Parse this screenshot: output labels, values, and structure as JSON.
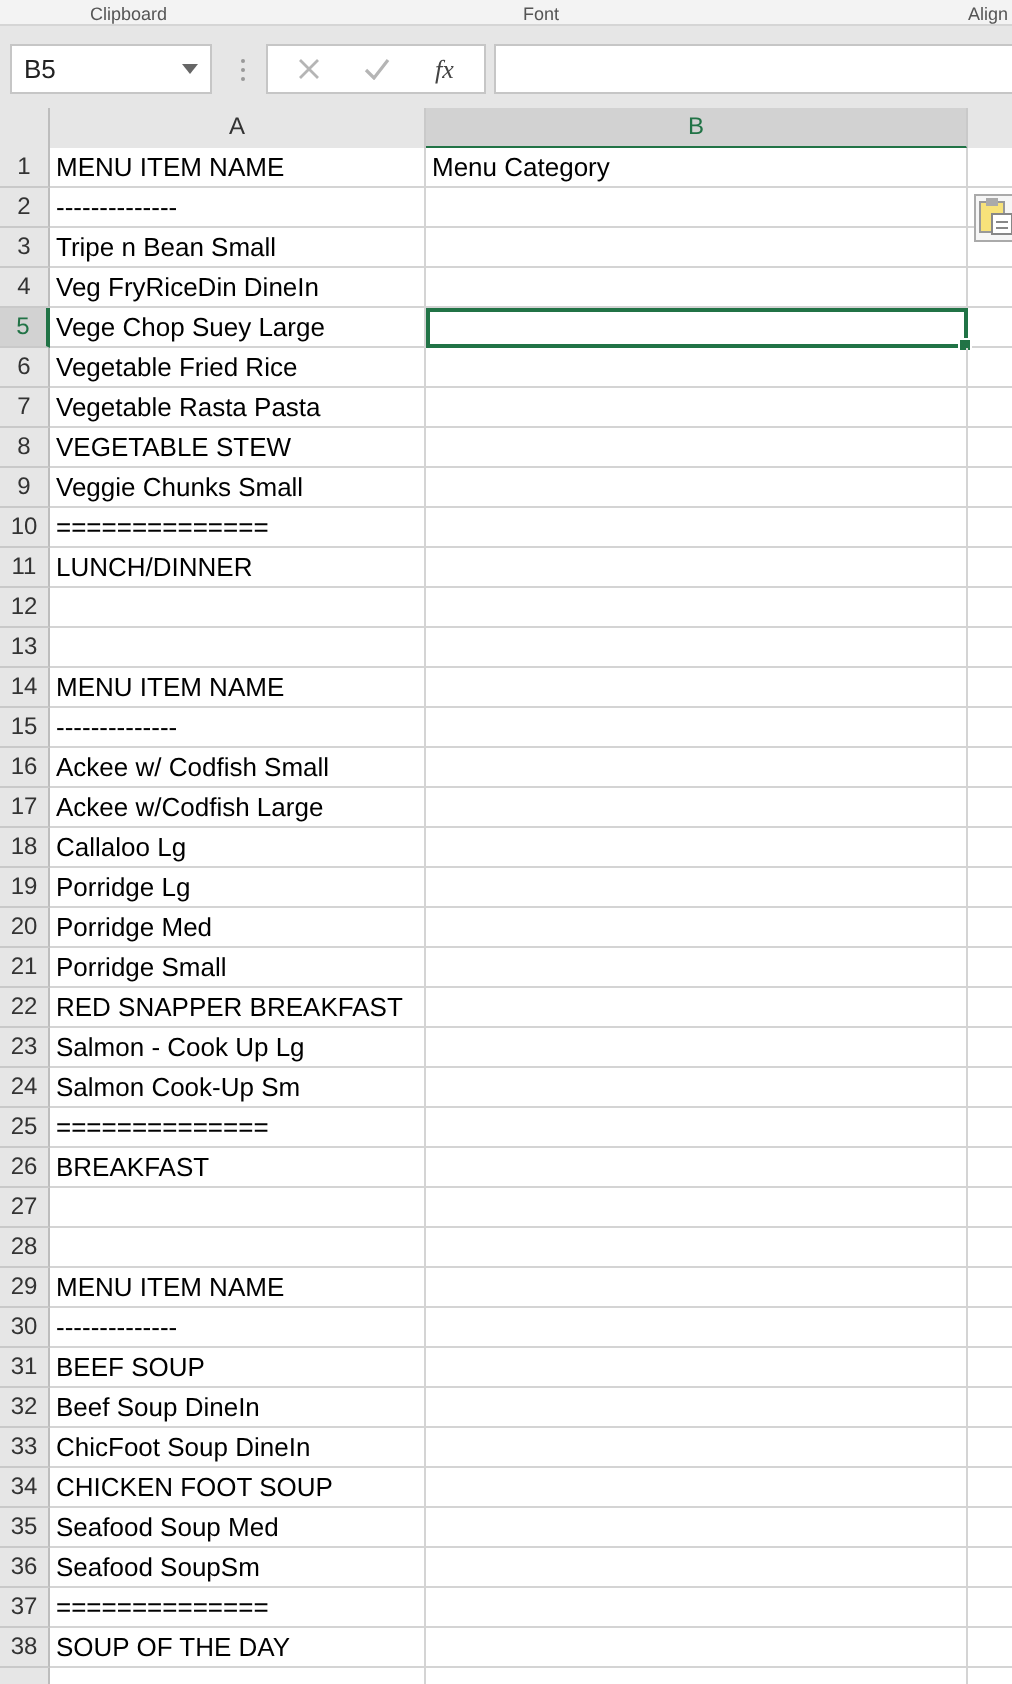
{
  "ribbon": {
    "groups": [
      "Clipboard",
      "Font",
      "Align"
    ]
  },
  "formula_bar": {
    "name_box": "B5",
    "function_button": "fx"
  },
  "columns": [
    {
      "label": "A",
      "selected": false
    },
    {
      "label": "B",
      "selected": true
    }
  ],
  "rows": [
    {
      "number": "1",
      "a": "MENU ITEM NAME",
      "b": "Menu Category",
      "selected": false
    },
    {
      "number": "2",
      "a": "--------------",
      "selected": false
    },
    {
      "number": "3",
      "a": "Tripe n Bean Small",
      "selected": false
    },
    {
      "number": "4",
      "a": "Veg FryRiceDin DineIn",
      "selected": false
    },
    {
      "number": "5",
      "a": "Vege Chop Suey Large",
      "selected": true
    },
    {
      "number": "6",
      "a": "Vegetable Fried Rice",
      "selected": false
    },
    {
      "number": "7",
      "a": "Vegetable Rasta Pasta",
      "selected": false
    },
    {
      "number": "8",
      "a": "VEGETABLE STEW",
      "selected": false
    },
    {
      "number": "9",
      "a": "Veggie Chunks Small",
      "selected": false
    },
    {
      "number": "10",
      "a": "==============",
      "selected": false
    },
    {
      "number": "11",
      "a": "LUNCH/DINNER",
      "selected": false
    },
    {
      "number": "12",
      "selected": false
    },
    {
      "number": "13",
      "selected": false
    },
    {
      "number": "14",
      "a": "MENU ITEM NAME",
      "selected": false
    },
    {
      "number": "15",
      "a": "--------------",
      "selected": false
    },
    {
      "number": "16",
      "a": "Ackee w/ Codfish Small",
      "selected": false
    },
    {
      "number": "17",
      "a": "Ackee w/Codfish Large",
      "selected": false
    },
    {
      "number": "18",
      "a": "Callaloo Lg",
      "selected": false
    },
    {
      "number": "19",
      "a": "Porridge Lg",
      "selected": false
    },
    {
      "number": "20",
      "a": "Porridge Med",
      "selected": false
    },
    {
      "number": "21",
      "a": "Porridge Small",
      "selected": false
    },
    {
      "number": "22",
      "a": "RED SNAPPER BREAKFAST",
      "selected": false
    },
    {
      "number": "23",
      "a": "Salmon - Cook Up Lg",
      "selected": false
    },
    {
      "number": "24",
      "a": "Salmon Cook-Up Sm",
      "selected": false
    },
    {
      "number": "25",
      "a": "==============",
      "selected": false
    },
    {
      "number": "26",
      "a": "BREAKFAST",
      "selected": false
    },
    {
      "number": "27",
      "selected": false
    },
    {
      "number": "28",
      "selected": false
    },
    {
      "number": "29",
      "a": "MENU ITEM NAME",
      "selected": false
    },
    {
      "number": "30",
      "a": "--------------",
      "selected": false
    },
    {
      "number": "31",
      "a": "BEEF SOUP",
      "selected": false
    },
    {
      "number": "32",
      "a": "Beef Soup DineIn",
      "selected": false
    },
    {
      "number": "33",
      "a": "ChicFoot Soup DineIn",
      "selected": false
    },
    {
      "number": "34",
      "a": "CHICKEN FOOT SOUP",
      "selected": false
    },
    {
      "number": "35",
      "a": "Seafood Soup Med",
      "selected": false
    },
    {
      "number": "36",
      "a": "Seafood SoupSm",
      "selected": false
    },
    {
      "number": "37",
      "a": "==============",
      "selected": false
    },
    {
      "number": "38",
      "a": "SOUP OF THE DAY",
      "selected": false
    }
  ]
}
